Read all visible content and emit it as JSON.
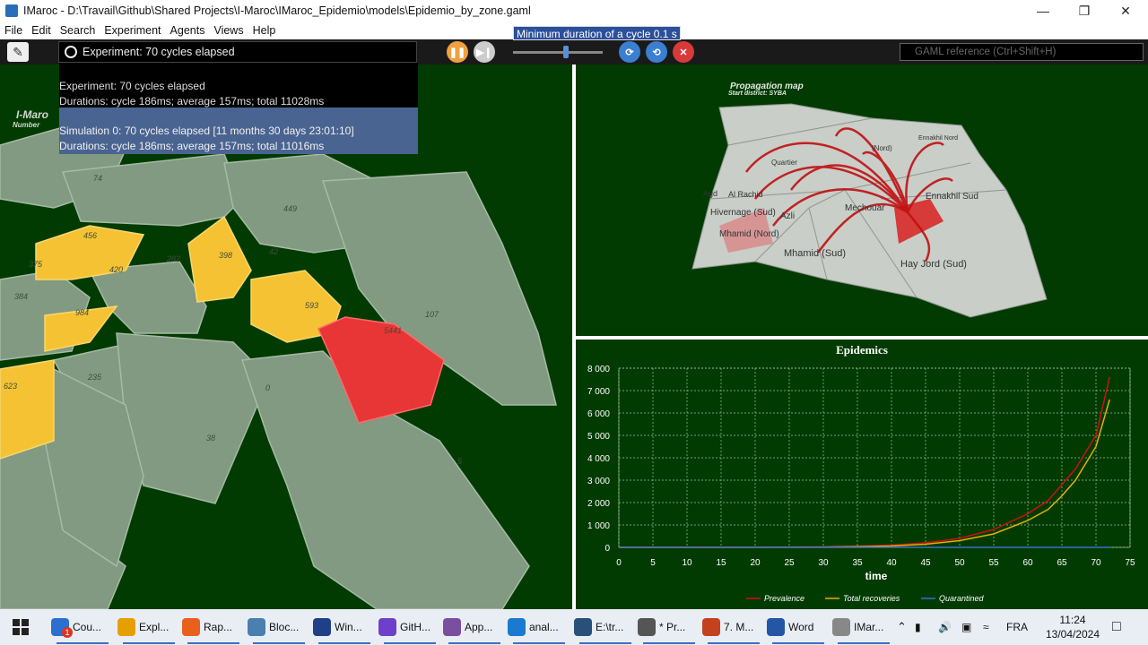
{
  "window": {
    "title": "IMaroc - D:\\Travail\\Github\\Shared Projects\\I-Maroc\\IMaroc_Epidemio\\models\\Epidemio_by_zone.gaml"
  },
  "menu": [
    "File",
    "Edit",
    "Search",
    "Experiment",
    "Agents",
    "Views",
    "Help"
  ],
  "toolbar": {
    "status": "Experiment: 70 cycles elapsed",
    "tooltip": "Minimum duration of a cycle 0.1 s",
    "search_placeholder": "GAML reference (Ctrl+Shift+H)"
  },
  "popup": {
    "experiment_line1": "Experiment: 70 cycles elapsed",
    "experiment_line2": "Durations: cycle 186ms; average 157ms; total 11028ms",
    "simulation_line1": "Simulation 0: 70 cycles elapsed [11 months 30 days 23:01:10]",
    "simulation_line2": "Durations: cycle 186ms; average 157ms; total 11016ms"
  },
  "left_map": {
    "title": "I-Maro",
    "subtitle": "Number",
    "labels": [
      "74",
      "449",
      "456",
      "420",
      "282",
      "398",
      "42",
      "375",
      "384",
      "984",
      "593",
      "5441",
      "107",
      "623",
      "235",
      "0",
      "38",
      "5"
    ]
  },
  "propagation_map": {
    "title": "Propagation map",
    "subtitle": "Start district: SYBA",
    "districts": [
      "Ennakhil Nord",
      "(Nord)",
      "Quartier",
      "Agd",
      "Azli",
      "Al Rachid",
      "Ennakhil Sud",
      "Mechouar",
      "Hivernage (Sud)",
      "Mhamid (Nord)",
      "Mhamid (Sud)",
      "Hay Jord (Sud)"
    ]
  },
  "chart_data": {
    "type": "line",
    "title": "Epidemics",
    "xlabel": "time",
    "ylabel": "",
    "xlim": [
      0,
      75
    ],
    "ylim": [
      0,
      8000
    ],
    "x_ticks": [
      "0",
      "5",
      "10",
      "15",
      "20",
      "25",
      "30",
      "35",
      "40",
      "45",
      "50",
      "55",
      "60",
      "65",
      "70",
      "75"
    ],
    "y_ticks": [
      "0",
      "1 000",
      "2 000",
      "3 000",
      "4 000",
      "5 000",
      "6 000",
      "7 000",
      "8 000"
    ],
    "x": [
      0,
      10,
      20,
      30,
      35,
      40,
      45,
      50,
      55,
      60,
      63,
      65,
      67,
      70,
      72
    ],
    "series": [
      {
        "name": "Prevalence",
        "color": "#cc1111",
        "values": [
          0,
          0,
          5,
          20,
          50,
          100,
          200,
          400,
          800,
          1500,
          2100,
          2800,
          3500,
          5000,
          7600
        ]
      },
      {
        "name": "Total recoveries",
        "color": "#e0b000",
        "values": [
          0,
          0,
          0,
          10,
          30,
          60,
          140,
          300,
          600,
          1200,
          1700,
          2300,
          3000,
          4500,
          6600
        ]
      },
      {
        "name": "Quarantined",
        "color": "#3a6fc8",
        "values": [
          0,
          0,
          0,
          0,
          0,
          0,
          0,
          0,
          0,
          0,
          0,
          0,
          0,
          0,
          0
        ]
      }
    ]
  },
  "taskbar": {
    "items": [
      {
        "label": "Cou...",
        "badge": "1",
        "color": "#2b6fd1"
      },
      {
        "label": "Expl...",
        "color": "#e5a000"
      },
      {
        "label": "Rap...",
        "color": "#e8601c"
      },
      {
        "label": "Bloc...",
        "color": "#4a7fb0"
      },
      {
        "label": "Win...",
        "color": "#1f3f88"
      },
      {
        "label": "GitH...",
        "color": "#6e40c9"
      },
      {
        "label": "App...",
        "color": "#7a4fa0"
      },
      {
        "label": "anal...",
        "color": "#1a7ad0"
      },
      {
        "label": "E:\\tr...",
        "color": "#29507a"
      },
      {
        "label": "* Pr...",
        "color": "#555"
      },
      {
        "label": "7. M...",
        "color": "#c4411e"
      },
      {
        "label": "Word",
        "color": "#2456a6"
      },
      {
        "label": "IMar...",
        "color": "#888"
      }
    ],
    "lang": "FRA",
    "time": "11:24",
    "date": "13/04/2024"
  }
}
